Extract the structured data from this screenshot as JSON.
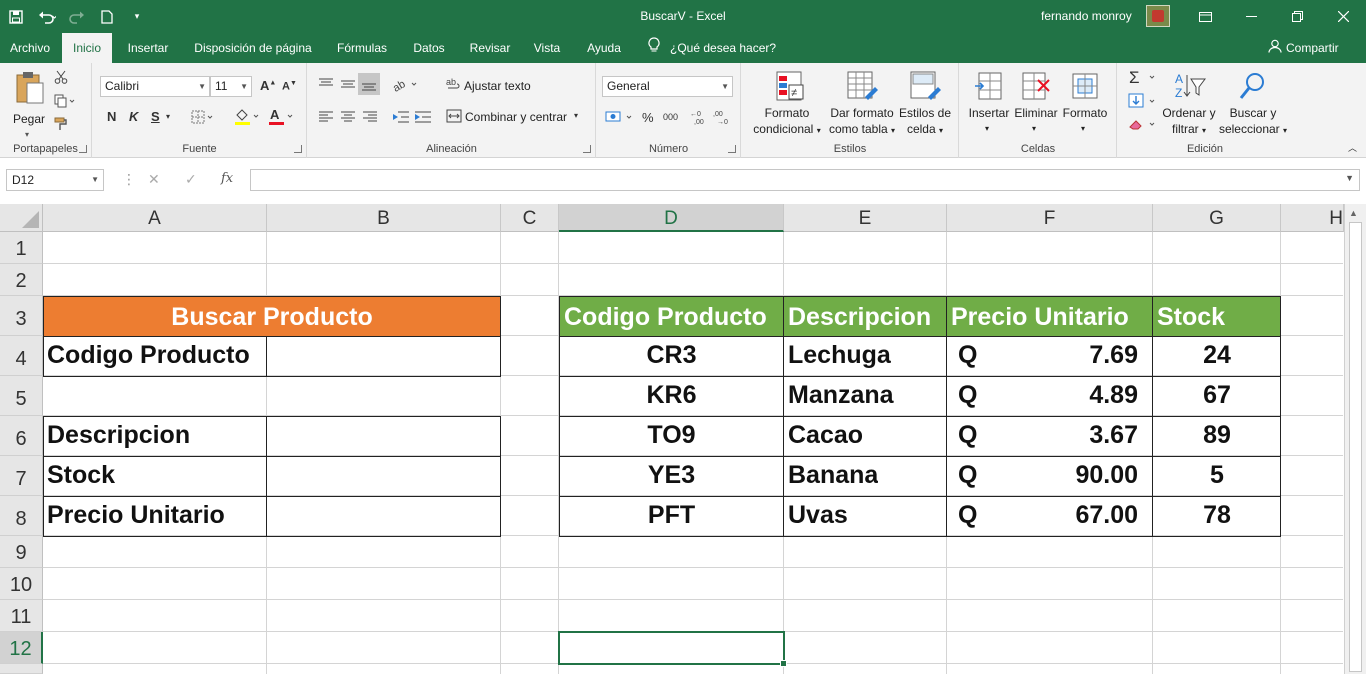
{
  "window": {
    "title": "BuscarV  -  Excel",
    "user": "fernando monroy"
  },
  "tabs": [
    "Archivo",
    "Inicio",
    "Insertar",
    "Disposición de página",
    "Fórmulas",
    "Datos",
    "Revisar",
    "Vista",
    "Ayuda"
  ],
  "active_tab": "Inicio",
  "tell_me": "¿Qué desea hacer?",
  "share": "Compartir",
  "ribbon": {
    "clipboard": {
      "label": "Portapapeles",
      "paste": "Pegar"
    },
    "font": {
      "label": "Fuente",
      "name": "Calibri",
      "size": "11",
      "bold": "N",
      "italic": "K",
      "underline": "S"
    },
    "alignment": {
      "label": "Alineación",
      "wrap": "Ajustar texto",
      "merge": "Combinar y centrar"
    },
    "number": {
      "label": "Número",
      "format": "General",
      "percent": "%",
      "thousands": "000"
    },
    "styles": {
      "label": "Estilos",
      "conditional": [
        "Formato",
        "condicional"
      ],
      "as_table": [
        "Dar formato",
        "como tabla"
      ],
      "cell_styles": [
        "Estilos de",
        "celda"
      ]
    },
    "cells": {
      "label": "Celdas",
      "insert": "Insertar",
      "delete": "Eliminar",
      "format": "Formato"
    },
    "editing": {
      "label": "Edición",
      "sort": [
        "Ordenar y",
        "filtrar"
      ],
      "find": [
        "Buscar y",
        "seleccionar"
      ]
    }
  },
  "formula_bar": {
    "name_box": "D12",
    "fx": "fx",
    "value": ""
  },
  "columns": [
    "A",
    "B",
    "C",
    "D",
    "E",
    "F",
    "G",
    "H"
  ],
  "rows": [
    "1",
    "2",
    "3",
    "4",
    "5",
    "6",
    "7",
    "8",
    "9",
    "10",
    "11",
    "12"
  ],
  "selected_cell": {
    "column": "D",
    "row": "12"
  },
  "search_table": {
    "header": "Buscar Producto",
    "labels": {
      "codigo": "Codigo Producto",
      "descripcion": "Descripcion",
      "stock": "Stock",
      "precio": "Precio Unitario"
    }
  },
  "product_table": {
    "headers": [
      "Codigo Producto",
      "Descripcion",
      "Precio Unitario",
      "Stock"
    ],
    "rows": [
      {
        "codigo": "CR3",
        "descripcion": "Lechuga",
        "currency": "Q",
        "precio": "7.69",
        "stock": "24"
      },
      {
        "codigo": "KR6",
        "descripcion": "Manzana",
        "currency": "Q",
        "precio": "4.89",
        "stock": "67"
      },
      {
        "codigo": "TO9",
        "descripcion": "Cacao",
        "currency": "Q",
        "precio": "3.67",
        "stock": "89"
      },
      {
        "codigo": "YE3",
        "descripcion": "Banana",
        "currency": "Q",
        "precio": "90.00",
        "stock": "5"
      },
      {
        "codigo": "PFT",
        "descripcion": "Uvas",
        "currency": "Q",
        "precio": "67.00",
        "stock": "78"
      }
    ]
  },
  "colors": {
    "excel_green": "#217346",
    "orange_header": "#ed7d31",
    "green_header": "#70ad47"
  }
}
